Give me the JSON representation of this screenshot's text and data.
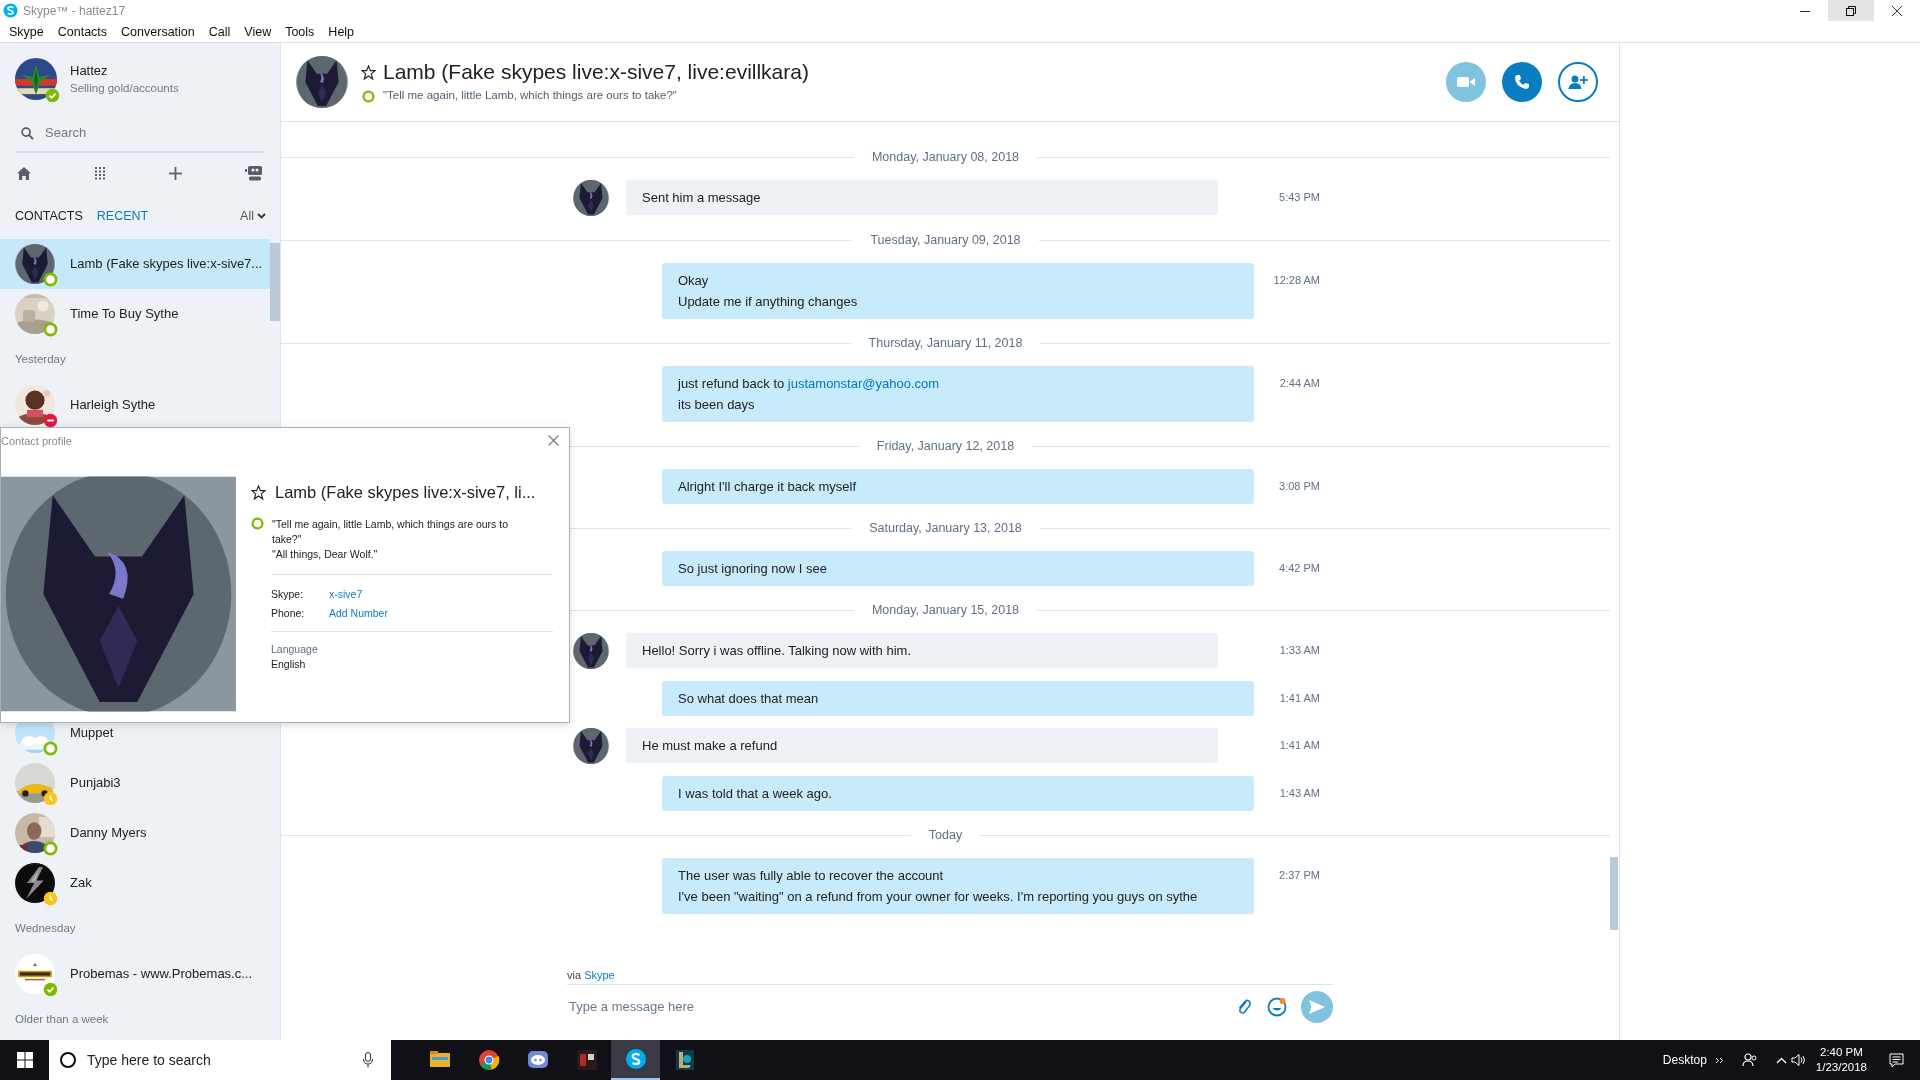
{
  "window": {
    "title": "Skype™ - hattez17",
    "menu": [
      "Skype",
      "Contacts",
      "Conversation",
      "Call",
      "View",
      "Tools",
      "Help"
    ]
  },
  "profile": {
    "name": "Hattez",
    "mood": "Selling gold/accounts",
    "status": {
      "kind": "check",
      "color": "#7fba00"
    }
  },
  "search": {
    "placeholder": "Search"
  },
  "tabs": [
    {
      "label": "CONTACTS",
      "selected": false
    },
    {
      "label": "RECENT",
      "selected": true
    }
  ],
  "filter": {
    "label": "All"
  },
  "sidebar": {
    "upper_entries": [
      {
        "kind": "contact",
        "name": "Lamb (Fake skypes live:x-sive7...",
        "status": {
          "kind": "ring",
          "color": "#7fba00"
        },
        "selected": true
      },
      {
        "kind": "contact",
        "name": "Time To Buy Sythe",
        "status": {
          "kind": "ring",
          "color": "#7fba00"
        },
        "selected": false
      },
      {
        "kind": "heading",
        "text": "Yesterday"
      },
      {
        "kind": "contact",
        "name": "Harleigh Sythe",
        "status": {
          "kind": "minus",
          "color": "#e3173e"
        },
        "selected": false
      }
    ],
    "lower_entries": [
      {
        "kind": "contact",
        "name": "Muppet",
        "status": {
          "kind": "ring",
          "color": "#7fba00"
        },
        "selected": false
      },
      {
        "kind": "contact",
        "name": "Punjabi3",
        "status": {
          "kind": "clock",
          "color": "#fcc419"
        },
        "selected": false
      },
      {
        "kind": "contact",
        "name": "Danny Myers",
        "status": {
          "kind": "ring",
          "color": "#7fba00"
        },
        "selected": false
      },
      {
        "kind": "contact",
        "name": "Zak",
        "status": {
          "kind": "clock",
          "color": "#fcc419"
        },
        "selected": false
      },
      {
        "kind": "heading",
        "text": "Wednesday"
      },
      {
        "kind": "contact",
        "name": "Probemas - www.Probemas.c...",
        "status": {
          "kind": "check",
          "color": "#7fba00"
        },
        "selected": false
      },
      {
        "kind": "heading",
        "text": "Older than a week"
      }
    ]
  },
  "conversation": {
    "title": "Lamb (Fake skypes live:x-sive7, live:evillkara)",
    "favorite": false,
    "status": {
      "kind": "ring",
      "color": "#7fba00"
    },
    "mood": "\"Tell me again, little Lamb, which things are ours to take?\""
  },
  "timeline": [
    {
      "kind": "date",
      "text": "Monday, January 08, 2018"
    },
    {
      "kind": "incoming",
      "lines": [
        "Sent him a message"
      ],
      "time": "5:43 PM"
    },
    {
      "kind": "date",
      "text": "Tuesday, January 09, 2018"
    },
    {
      "kind": "outgoing",
      "lines": [
        "Okay",
        "Update me if anything changes"
      ],
      "time": "12:28 AM"
    },
    {
      "kind": "date",
      "text": "Thursday, January 11, 2018"
    },
    {
      "kind": "outgoing",
      "lines": [
        {
          "text": "just refund back to",
          "link": "justamonstar@yahoo.com"
        },
        "its been days"
      ],
      "time": "2:44 AM"
    },
    {
      "kind": "date",
      "text": "Friday, January 12, 2018"
    },
    {
      "kind": "outgoing",
      "lines": [
        "Alright I'll charge it back myself"
      ],
      "time": "3:08 PM"
    },
    {
      "kind": "date",
      "text": "Saturday, January 13, 2018"
    },
    {
      "kind": "outgoing",
      "lines": [
        "So just ignoring now I see"
      ],
      "time": "4:42 PM"
    },
    {
      "kind": "date",
      "text": "Monday, January 15, 2018"
    },
    {
      "kind": "incoming",
      "lines": [
        "Hello! Sorry i was offline. Talking now with him."
      ],
      "time": "1:33 AM"
    },
    {
      "kind": "outgoing",
      "lines": [
        "So what does that mean"
      ],
      "time": "1:41 AM"
    },
    {
      "kind": "incoming",
      "lines": [
        "He must make a refund"
      ],
      "time": "1:41 AM"
    },
    {
      "kind": "outgoing",
      "lines": [
        "I was told that a week ago."
      ],
      "time": "1:43 AM"
    },
    {
      "kind": "date",
      "text": "Today"
    },
    {
      "kind": "outgoing",
      "lines": [
        "The user was fully able to recover the account",
        "I've been \"waiting\" on a refund from your owner for weeks. I'm reporting you guys on sythe"
      ],
      "time": "2:37 PM"
    }
  ],
  "composer": {
    "via": "via",
    "via_link": "Skype",
    "placeholder": "Type a message here"
  },
  "contact_profile": {
    "title": "Contact profile",
    "name": "Lamb (Fake skypes live:x-sive7, li...",
    "favorite": false,
    "status": {
      "kind": "ring",
      "color": "#7fba00"
    },
    "mood_lines": [
      "\"Tell me again, little Lamb, which things are ours to take?\"",
      "\"All things, Dear Wolf.\""
    ],
    "fields": [
      {
        "label": "Skype:",
        "value": "x-sive7"
      },
      {
        "label": "Phone:",
        "value": "Add Number"
      }
    ],
    "language_label": "Language",
    "language": "English"
  },
  "taskbar": {
    "search_placeholder": "Type here to search",
    "apps": [
      {
        "active": false
      },
      {
        "active": false
      },
      {
        "active": false
      },
      {
        "active": false
      },
      {
        "active": true
      },
      {
        "active": false
      }
    ],
    "desktop_label": "Desktop",
    "time": "2:40 PM",
    "date": "1/23/2018"
  }
}
